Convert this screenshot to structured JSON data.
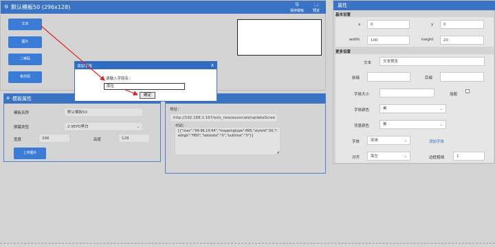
{
  "header": {
    "title": "默认模板50 (296x128)",
    "save_label": "保存模板",
    "preview_label": "预览"
  },
  "left_buttons": [
    "文本",
    "图片",
    "二维码",
    "条形码"
  ],
  "template_props": {
    "title": "模板属性",
    "name_label": "模板名称",
    "name_value": "默认模板50",
    "screen_label": "屏幕类型",
    "screen_value": "2.9EPD黑白",
    "width_label": "宽度",
    "width_value": "296",
    "height_label": "高度",
    "height_value": "128",
    "upload_label": "上传图片"
  },
  "address": {
    "label": "地址：",
    "url": "http://192.168.1.167/esls_new/associate/updateScree",
    "code_label": "代码：",
    "code_text": "[{\"mac\":\"99.96.19.64\",\"mappingtype\":895,\"styleid\":50,\"ledrgb\":\"ff00\",\"ledstate\":\"0\",\"outtime\":\"0\"}]"
  },
  "dialog": {
    "title": "添加字段",
    "close": "x",
    "prompt": "请输入字段名：",
    "value": "库位",
    "ok_label": "确定"
  },
  "properties": {
    "title": "属性",
    "basic_title": "基本设置",
    "x_label": "x",
    "x_value": "0",
    "y_label": "y",
    "y_value": "0",
    "width_label": "width",
    "width_value": "100",
    "height_label": "height",
    "height_value": "20",
    "more_title": "更多设置",
    "text_label": "文本",
    "text_value": "文本预览",
    "prefix_label": "前缀",
    "suffix_label": "后缀",
    "fontsize_label": "字体大小",
    "bold_label": "加粗",
    "fontcolor_label": "字体颜色",
    "fontcolor_value": "黑",
    "bgcolor_label": "背景颜色",
    "bgcolor_value": "黑",
    "font_label": "字体",
    "font_value": "宋体",
    "add_font_label": "添加字体",
    "align_label": "对齐",
    "align_value": "靠左",
    "border_label": "边框粗细",
    "border_value": "1"
  }
}
